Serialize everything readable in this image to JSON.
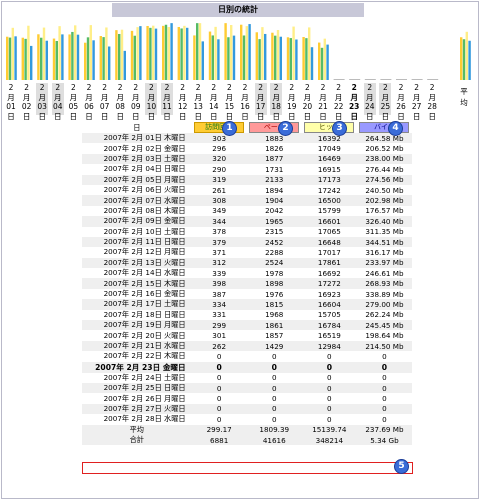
{
  "title": "日別の統計",
  "legend_numbers": [
    "1",
    "2",
    "3",
    "4",
    "5"
  ],
  "colors": {
    "visits": "#ffcc33",
    "pages": "#55bb66",
    "hits": "#ffee88",
    "bytes": "#3399dd"
  },
  "day_columns": [
    {
      "m": "2月",
      "d": "01",
      "w": "日",
      "weekend": false
    },
    {
      "m": "2月",
      "d": "02",
      "w": "日",
      "weekend": false
    },
    {
      "m": "2月",
      "d": "03",
      "w": "日",
      "weekend": true
    },
    {
      "m": "2月",
      "d": "04",
      "w": "日",
      "weekend": true
    },
    {
      "m": "2月",
      "d": "05",
      "w": "日",
      "weekend": false
    },
    {
      "m": "2月",
      "d": "06",
      "w": "日",
      "weekend": false
    },
    {
      "m": "2月",
      "d": "07",
      "w": "日",
      "weekend": false
    },
    {
      "m": "2月",
      "d": "08",
      "w": "日",
      "weekend": false
    },
    {
      "m": "2月",
      "d": "09",
      "w": "日",
      "weekend": false
    },
    {
      "m": "2月",
      "d": "10",
      "w": "日",
      "weekend": true
    },
    {
      "m": "2月",
      "d": "11",
      "w": "日",
      "weekend": true
    },
    {
      "m": "2月",
      "d": "12",
      "w": "日",
      "weekend": false
    },
    {
      "m": "2月",
      "d": "13",
      "w": "日",
      "weekend": false
    },
    {
      "m": "2月",
      "d": "14",
      "w": "日",
      "weekend": false
    },
    {
      "m": "2月",
      "d": "15",
      "w": "日",
      "weekend": false
    },
    {
      "m": "2月",
      "d": "16",
      "w": "日",
      "weekend": false
    },
    {
      "m": "2月",
      "d": "17",
      "w": "日",
      "weekend": true
    },
    {
      "m": "2月",
      "d": "18",
      "w": "日",
      "weekend": true
    },
    {
      "m": "2月",
      "d": "19",
      "w": "日",
      "weekend": false
    },
    {
      "m": "2月",
      "d": "20",
      "w": "日",
      "weekend": false
    },
    {
      "m": "2月",
      "d": "21",
      "w": "日",
      "weekend": false
    },
    {
      "m": "2月",
      "d": "22",
      "w": "日",
      "weekend": false
    },
    {
      "m": "2月",
      "d": "23",
      "w": "日",
      "weekend": false,
      "today": true
    },
    {
      "m": "2月",
      "d": "24",
      "w": "日",
      "weekend": true
    },
    {
      "m": "2月",
      "d": "25",
      "w": "日",
      "weekend": true
    },
    {
      "m": "2月",
      "d": "26",
      "w": "日",
      "weekend": false
    },
    {
      "m": "2月",
      "d": "27",
      "w": "日",
      "weekend": false
    },
    {
      "m": "2月",
      "d": "28",
      "w": "日",
      "weekend": false
    }
  ],
  "average_label": "平均",
  "table": {
    "col_day": "日",
    "col_visits": "訪問回数",
    "col_pages": "ページ",
    "col_hits": "ヒット",
    "col_bytes": "バイト",
    "rows": [
      {
        "date": "2007年 2月 01日 木曜日",
        "v": "303",
        "p": "1883",
        "h": "16392",
        "b": "264.58 Mb"
      },
      {
        "date": "2007年 2月 02日 金曜日",
        "v": "296",
        "p": "1826",
        "h": "17049",
        "b": "206.52 Mb"
      },
      {
        "date": "2007年 2月 03日 土曜日",
        "v": "320",
        "p": "1877",
        "h": "16469",
        "b": "238.00 Mb"
      },
      {
        "date": "2007年 2月 04日 日曜日",
        "v": "290",
        "p": "1731",
        "h": "16915",
        "b": "276.44 Mb"
      },
      {
        "date": "2007年 2月 05日 月曜日",
        "v": "319",
        "p": "2133",
        "h": "17173",
        "b": "274.56 Mb"
      },
      {
        "date": "2007年 2月 06日 火曜日",
        "v": "261",
        "p": "1894",
        "h": "17242",
        "b": "240.50 Mb"
      },
      {
        "date": "2007年 2月 07日 水曜日",
        "v": "308",
        "p": "1904",
        "h": "16500",
        "b": "202.98 Mb"
      },
      {
        "date": "2007年 2月 08日 木曜日",
        "v": "349",
        "p": "2042",
        "h": "15799",
        "b": "176.57 Mb"
      },
      {
        "date": "2007年 2月 09日 金曜日",
        "v": "344",
        "p": "1965",
        "h": "16601",
        "b": "326.40 Mb"
      },
      {
        "date": "2007年 2月 10日 土曜日",
        "v": "378",
        "p": "2315",
        "h": "17065",
        "b": "311.35 Mb"
      },
      {
        "date": "2007年 2月 11日 日曜日",
        "v": "379",
        "p": "2452",
        "h": "16648",
        "b": "344.51 Mb"
      },
      {
        "date": "2007年 2月 12日 月曜日",
        "v": "371",
        "p": "2288",
        "h": "17017",
        "b": "316.17 Mb"
      },
      {
        "date": "2007年 2月 13日 火曜日",
        "v": "312",
        "p": "2524",
        "h": "17861",
        "b": "233.97 Mb"
      },
      {
        "date": "2007年 2月 14日 水曜日",
        "v": "339",
        "p": "1978",
        "h": "16692",
        "b": "246.61 Mb"
      },
      {
        "date": "2007年 2月 15日 木曜日",
        "v": "398",
        "p": "1898",
        "h": "17272",
        "b": "268.93 Mb"
      },
      {
        "date": "2007年 2月 16日 金曜日",
        "v": "387",
        "p": "1976",
        "h": "16923",
        "b": "338.89 Mb"
      },
      {
        "date": "2007年 2月 17日 土曜日",
        "v": "334",
        "p": "1815",
        "h": "16604",
        "b": "279.00 Mb"
      },
      {
        "date": "2007年 2月 18日 日曜日",
        "v": "331",
        "p": "1968",
        "h": "15705",
        "b": "262.24 Mb"
      },
      {
        "date": "2007年 2月 19日 月曜日",
        "v": "299",
        "p": "1861",
        "h": "16784",
        "b": "245.45 Mb"
      },
      {
        "date": "2007年 2月 20日 火曜日",
        "v": "301",
        "p": "1857",
        "h": "16519",
        "b": "198.64 Mb"
      },
      {
        "date": "2007年 2月 21日 水曜日",
        "v": "262",
        "p": "1429",
        "h": "12984",
        "b": "214.50 Mb"
      },
      {
        "date": "2007年 2月 22日 木曜日",
        "v": "0",
        "p": "0",
        "h": "0",
        "b": "0"
      },
      {
        "date": "2007年 2月 23日 金曜日",
        "v": "0",
        "p": "0",
        "h": "0",
        "b": "0",
        "today": true
      },
      {
        "date": "2007年 2月 24日 土曜日",
        "v": "0",
        "p": "0",
        "h": "0",
        "b": "0"
      },
      {
        "date": "2007年 2月 25日 日曜日",
        "v": "0",
        "p": "0",
        "h": "0",
        "b": "0"
      },
      {
        "date": "2007年 2月 26日 月曜日",
        "v": "0",
        "p": "0",
        "h": "0",
        "b": "0"
      },
      {
        "date": "2007年 2月 27日 火曜日",
        "v": "0",
        "p": "0",
        "h": "0",
        "b": "0"
      },
      {
        "date": "2007年 2月 28日 水曜日",
        "v": "0",
        "p": "0",
        "h": "0",
        "b": "0"
      }
    ],
    "average": {
      "label": "平均",
      "v": "299.17",
      "p": "1809.39",
      "h": "15139.74",
      "b": "237.69 Mb"
    },
    "total": {
      "label": "合計",
      "v": "6881",
      "p": "41616",
      "h": "348214",
      "b": "5.34 Gb"
    }
  },
  "chart_data": {
    "type": "bar",
    "categories": [
      "01",
      "02",
      "03",
      "04",
      "05",
      "06",
      "07",
      "08",
      "09",
      "10",
      "11",
      "12",
      "13",
      "14",
      "15",
      "16",
      "17",
      "18",
      "19",
      "20",
      "21",
      "22",
      "23",
      "24",
      "25",
      "26",
      "27",
      "28",
      "平均"
    ],
    "series": [
      {
        "name": "訪問回数",
        "values": [
          303,
          296,
          320,
          290,
          319,
          261,
          308,
          349,
          344,
          378,
          379,
          371,
          312,
          339,
          398,
          387,
          334,
          331,
          299,
          301,
          262,
          0,
          0,
          0,
          0,
          0,
          0,
          0,
          299.17
        ]
      },
      {
        "name": "ページ",
        "values": [
          1883,
          1826,
          1877,
          1731,
          2133,
          1894,
          1904,
          2042,
          1965,
          2315,
          2452,
          2288,
          2524,
          1978,
          1898,
          1976,
          1815,
          1968,
          1861,
          1857,
          1429,
          0,
          0,
          0,
          0,
          0,
          0,
          0,
          1809.39
        ]
      },
      {
        "name": "ヒット",
        "values": [
          16392,
          17049,
          16469,
          16915,
          17173,
          17242,
          16500,
          15799,
          16601,
          17065,
          16648,
          17017,
          17861,
          16692,
          17272,
          16923,
          16604,
          15705,
          16784,
          16519,
          12984,
          0,
          0,
          0,
          0,
          0,
          0,
          0,
          15139.74
        ]
      },
      {
        "name": "バイト",
        "values": [
          264.58,
          206.52,
          238.0,
          276.44,
          274.56,
          240.5,
          202.98,
          176.57,
          326.4,
          311.35,
          344.51,
          316.17,
          233.97,
          246.61,
          268.93,
          338.89,
          279.0,
          262.24,
          245.45,
          198.64,
          214.5,
          0,
          0,
          0,
          0,
          0,
          0,
          0,
          237.69
        ]
      }
    ]
  }
}
